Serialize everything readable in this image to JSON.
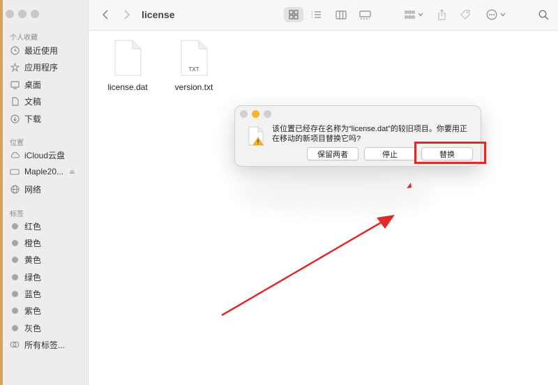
{
  "window": {
    "title": "license"
  },
  "sidebar": {
    "favorites_header": "个人收藏",
    "favorites": [
      {
        "label": "最近使用",
        "icon": "clock-icon"
      },
      {
        "label": "应用程序",
        "icon": "apps-icon"
      },
      {
        "label": "桌面",
        "icon": "desktop-icon"
      },
      {
        "label": "文稿",
        "icon": "document-icon"
      },
      {
        "label": "下载",
        "icon": "download-icon"
      }
    ],
    "locations_header": "位置",
    "locations": [
      {
        "label": "iCloud云盘",
        "icon": "cloud-icon"
      },
      {
        "label": "Maple20...",
        "icon": "drive-icon"
      },
      {
        "label": "网络",
        "icon": "globe-icon"
      }
    ],
    "tags_header": "标签",
    "tags": [
      {
        "label": "红色"
      },
      {
        "label": "橙色"
      },
      {
        "label": "黄色"
      },
      {
        "label": "绿色"
      },
      {
        "label": "蓝色"
      },
      {
        "label": "紫色"
      },
      {
        "label": "灰色"
      }
    ],
    "all_tags": "所有标签..."
  },
  "files": [
    {
      "name": "license.dat",
      "badge": ""
    },
    {
      "name": "version.txt",
      "badge": "TXT"
    }
  ],
  "dialog": {
    "message": "该位置已经存在名称为“license.dat”的较旧项目。你要用正在移动的新项目替换它吗?",
    "buttons": {
      "keep_both": "保留两者",
      "stop": "停止",
      "replace": "替换"
    }
  },
  "colors": {
    "highlight": "#e02a2a",
    "dialog_close": "#d0d0d0",
    "dialog_minimize": "#f5b430",
    "dialog_zoom": "#d0d0d0"
  }
}
